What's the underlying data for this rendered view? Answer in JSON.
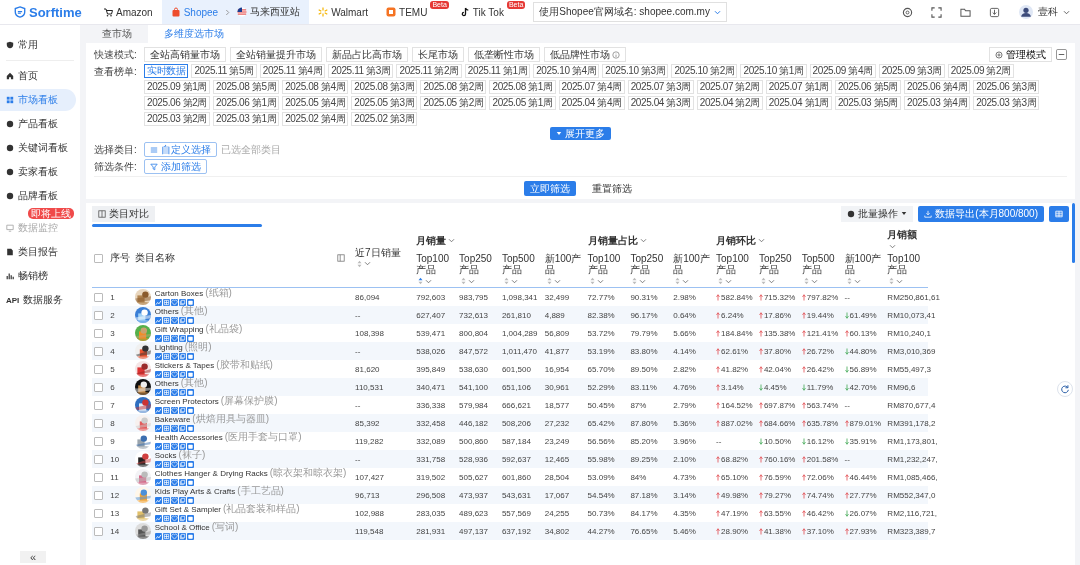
{
  "topbar": {
    "logo": "Sorftime",
    "platforms": [
      {
        "label": "Amazon",
        "selected": false
      },
      {
        "label": "Shopee",
        "selected": true,
        "site": "马来西亚站"
      },
      {
        "label": "Walmart",
        "selected": false
      },
      {
        "label": "TEMU",
        "selected": false,
        "beta": "Beta"
      },
      {
        "label": "Tik Tok",
        "selected": false,
        "beta": "Beta"
      }
    ],
    "domain": "使用Shopee官网域名: shopee.com.my",
    "user": "壹科"
  },
  "sidebar": {
    "items": [
      {
        "label": "常用",
        "selected": false,
        "disabled": false
      },
      {
        "label": "首页",
        "selected": false,
        "disabled": false
      },
      {
        "label": "市场看板",
        "selected": true,
        "disabled": false
      },
      {
        "label": "产品看板",
        "selected": false,
        "disabled": false
      },
      {
        "label": "关键词看板",
        "selected": false,
        "disabled": false
      },
      {
        "label": "卖家看板",
        "selected": false,
        "disabled": false
      },
      {
        "label": "品牌看板",
        "selected": false,
        "disabled": false
      },
      {
        "label": "数据监控",
        "selected": false,
        "disabled": true,
        "badge": "即将上线"
      },
      {
        "label": "类目报告",
        "selected": false,
        "disabled": false
      },
      {
        "label": "畅销榜",
        "selected": false,
        "disabled": false
      },
      {
        "label": "数据服务",
        "selected": false,
        "disabled": false,
        "prefix": "API"
      }
    ],
    "collapse": "«"
  },
  "tabs": [
    {
      "label": "查市场",
      "selected": false
    },
    {
      "label": "多维度选市场",
      "selected": true
    }
  ],
  "filters": {
    "quick": {
      "label": "快速模式:",
      "options": [
        "全站高销量市场",
        "全站销量提升市场",
        "新品占比高市场",
        "长尾市场",
        "低垄断性市场",
        "低品牌性市场"
      ],
      "manage": "管理模式"
    },
    "period": {
      "label": "查看榜单:",
      "options": [
        {
          "label": "实时数据",
          "selected": true
        },
        {
          "label": "2025.11 第5周",
          "selected": false
        },
        {
          "label": "2025.11 第4周",
          "selected": false
        },
        {
          "label": "2025.11 第3周",
          "selected": false
        },
        {
          "label": "2025.11 第2周",
          "selected": false
        },
        {
          "label": "2025.11 第1周",
          "selected": false
        },
        {
          "label": "2025.10 第4周",
          "selected": false
        },
        {
          "label": "2025.10 第3周",
          "selected": false
        },
        {
          "label": "2025.10 第2周",
          "selected": false
        },
        {
          "label": "2025.10 第1周",
          "selected": false
        },
        {
          "label": "2025.09 第4周",
          "selected": false
        },
        {
          "label": "2025.09 第3周",
          "selected": false
        },
        {
          "label": "2025.09 第2周",
          "selected": false
        },
        {
          "label": "2025.09 第1周",
          "selected": false
        },
        {
          "label": "2025.08 第5周",
          "selected": false
        },
        {
          "label": "2025.08 第4周",
          "selected": false
        },
        {
          "label": "2025.08 第3周",
          "selected": false
        },
        {
          "label": "2025.08 第2周",
          "selected": false
        },
        {
          "label": "2025.08 第1周",
          "selected": false
        },
        {
          "label": "2025.07 第4周",
          "selected": false
        },
        {
          "label": "2025.07 第3周",
          "selected": false
        },
        {
          "label": "2025.07 第2周",
          "selected": false
        },
        {
          "label": "2025.07 第1周",
          "selected": false
        },
        {
          "label": "2025.06 第5周",
          "selected": false
        },
        {
          "label": "2025.06 第4周",
          "selected": false
        },
        {
          "label": "2025.06 第3周",
          "selected": false
        },
        {
          "label": "2025.06 第2周",
          "selected": false
        },
        {
          "label": "2025.06 第1周",
          "selected": false
        },
        {
          "label": "2025.05 第4周",
          "selected": false
        },
        {
          "label": "2025.05 第3周",
          "selected": false
        },
        {
          "label": "2025.05 第2周",
          "selected": false
        },
        {
          "label": "2025.05 第1周",
          "selected": false
        },
        {
          "label": "2025.04 第4周",
          "selected": false
        },
        {
          "label": "2025.04 第3周",
          "selected": false
        },
        {
          "label": "2025.04 第2周",
          "selected": false
        },
        {
          "label": "2025.04 第1周",
          "selected": false
        },
        {
          "label": "2025.03 第5周",
          "selected": false
        },
        {
          "label": "2025.03 第4周",
          "selected": false
        },
        {
          "label": "2025.03 第3周",
          "selected": false
        },
        {
          "label": "2025.03 第2周",
          "selected": false
        },
        {
          "label": "2025.03 第1周",
          "selected": false
        },
        {
          "label": "2025.02 第4周",
          "selected": false
        },
        {
          "label": "2025.02 第3周",
          "selected": false
        }
      ],
      "expand": "展开更多"
    },
    "category": {
      "label": "选择类目:",
      "button": "自定义选择",
      "note": "已选全部类目"
    },
    "conditions": {
      "label": "筛选条件:",
      "button": "添加筛选"
    },
    "actions": [
      {
        "label": "立即筛选",
        "kind": "primary"
      },
      {
        "label": "重置筛选",
        "kind": "plain"
      }
    ]
  },
  "table": {
    "compare": "类目对比",
    "batch": "批量操作",
    "export": "数据导出(本月800/800)",
    "select_all": {
      "checked": false
    },
    "columns": {
      "index": "序号",
      "name": "类目名称",
      "sales_7d": "近7日销量",
      "groups": [
        {
          "label": "月销量",
          "subs": [
            "Top100产品",
            "Top250产品",
            "Top500产品",
            "新100产品"
          ]
        },
        {
          "label": "月销量占比",
          "subs": [
            "Top100产品",
            "Top250产品",
            "新100产品"
          ]
        },
        {
          "label": "月销环比",
          "subs": [
            "Top100产品",
            "Top250产品",
            "Top500产品",
            "新100产品"
          ]
        },
        {
          "label": "月销额",
          "subs": [
            "Top100产品"
          ]
        }
      ]
    },
    "rows": [
      {
        "checked": false,
        "index": "1",
        "name": "Carton Boxes",
        "name_cn": "(纸箱)",
        "sales_7d": "86,094",
        "sales": [
          "792,603",
          "983,795",
          "1,098,341",
          "32,499"
        ],
        "share": [
          "72.77%",
          "90.31%",
          "2.98%"
        ],
        "growth": [
          {
            "up": true,
            "value": "582.84%"
          },
          {
            "up": true,
            "value": "715.32%"
          },
          {
            "up": true,
            "value": "797.82%"
          },
          {
            "value": "--"
          }
        ],
        "revenue": "RM250,861,61"
      },
      {
        "checked": false,
        "index": "2",
        "name": "Others",
        "name_cn": "(其他)",
        "sales_7d": "--",
        "sales": [
          "627,407",
          "732,613",
          "261,810",
          "4,889"
        ],
        "share": [
          "82.38%",
          "96.17%",
          "0.64%"
        ],
        "growth": [
          {
            "up": true,
            "value": "6.24%"
          },
          {
            "up": true,
            "value": "17.86%"
          },
          {
            "up": true,
            "value": "19.44%"
          },
          {
            "up": false,
            "value": "61.49%"
          }
        ],
        "revenue": "RM10,073,41"
      },
      {
        "checked": false,
        "index": "3",
        "name": "Gift Wrapping",
        "name_cn": "(礼品袋)",
        "sales_7d": "108,398",
        "sales": [
          "539,471",
          "800,804",
          "1,004,289",
          "56,809"
        ],
        "share": [
          "53.72%",
          "79.79%",
          "5.66%"
        ],
        "growth": [
          {
            "up": true,
            "value": "184.84%"
          },
          {
            "up": true,
            "value": "135.38%"
          },
          {
            "up": true,
            "value": "121.41%"
          },
          {
            "up": true,
            "value": "60.13%"
          }
        ],
        "revenue": "RM10,240,1"
      },
      {
        "checked": false,
        "index": "4",
        "name": "Lighting",
        "name_cn": "(照明)",
        "sales_7d": "--",
        "sales": [
          "538,026",
          "847,572",
          "1,011,470",
          "41,877"
        ],
        "share": [
          "53.19%",
          "83.80%",
          "4.14%"
        ],
        "growth": [
          {
            "up": true,
            "value": "62.61%"
          },
          {
            "up": true,
            "value": "37.80%"
          },
          {
            "up": true,
            "value": "26.72%"
          },
          {
            "up": false,
            "value": "44.80%"
          }
        ],
        "revenue": "RM3,010,369"
      },
      {
        "checked": false,
        "index": "5",
        "name": "Stickers & Tapes",
        "name_cn": "(胶带和贴纸)",
        "sales_7d": "81,620",
        "sales": [
          "395,849",
          "538,630",
          "601,500",
          "16,954"
        ],
        "share": [
          "65.70%",
          "89.50%",
          "2.82%"
        ],
        "growth": [
          {
            "up": true,
            "value": "41.82%"
          },
          {
            "up": true,
            "value": "42.04%"
          },
          {
            "up": true,
            "value": "26.42%"
          },
          {
            "up": false,
            "value": "56.89%"
          }
        ],
        "revenue": "RM55,497,3"
      },
      {
        "checked": false,
        "index": "6",
        "name": "Others",
        "name_cn": "(其他)",
        "sales_7d": "110,531",
        "sales": [
          "340,471",
          "541,100",
          "651,106",
          "30,961"
        ],
        "share": [
          "52.29%",
          "83.11%",
          "4.76%"
        ],
        "growth": [
          {
            "up": true,
            "value": "3.14%"
          },
          {
            "up": false,
            "value": "4.45%"
          },
          {
            "up": false,
            "value": "11.79%"
          },
          {
            "up": false,
            "value": "42.70%"
          }
        ],
        "revenue": "RM96,6"
      },
      {
        "checked": false,
        "index": "7",
        "name": "Screen Protectors",
        "name_cn": "(屏幕保护膜)",
        "sales_7d": "--",
        "sales": [
          "336,338",
          "579,984",
          "666,621",
          "18,577"
        ],
        "share": [
          "50.45%",
          "87%",
          "2.79%"
        ],
        "growth": [
          {
            "up": true,
            "value": "164.52%"
          },
          {
            "up": true,
            "value": "697.87%"
          },
          {
            "up": true,
            "value": "563.74%"
          },
          {
            "value": "--"
          }
        ],
        "revenue": "RM870,677,4"
      },
      {
        "checked": false,
        "index": "8",
        "name": "Bakeware",
        "name_cn": "(烘焙用具与器皿)",
        "sales_7d": "85,392",
        "sales": [
          "332,458",
          "446,182",
          "508,206",
          "27,232"
        ],
        "share": [
          "65.42%",
          "87.80%",
          "5.36%"
        ],
        "growth": [
          {
            "up": true,
            "value": "887.02%"
          },
          {
            "up": true,
            "value": "684.66%"
          },
          {
            "up": true,
            "value": "635.78%"
          },
          {
            "up": true,
            "value": "879.01%"
          }
        ],
        "revenue": "RM391,178,2"
      },
      {
        "checked": false,
        "index": "9",
        "name": "Health Accessories",
        "name_cn": "(医用手套与口罩)",
        "sales_7d": "119,282",
        "sales": [
          "332,089",
          "500,860",
          "587,184",
          "23,249"
        ],
        "share": [
          "56.56%",
          "85.20%",
          "3.96%"
        ],
        "growth": [
          {
            "value": "--"
          },
          {
            "up": false,
            "value": "10.50%"
          },
          {
            "up": false,
            "value": "16.12%"
          },
          {
            "up": false,
            "value": "35.91%"
          }
        ],
        "revenue": "RM1,173,801,"
      },
      {
        "checked": false,
        "index": "10",
        "name": "Socks",
        "name_cn": "(袜子)",
        "sales_7d": "--",
        "sales": [
          "331,758",
          "528,936",
          "592,637",
          "12,465"
        ],
        "share": [
          "55.98%",
          "89.25%",
          "2.10%"
        ],
        "growth": [
          {
            "up": true,
            "value": "68.82%"
          },
          {
            "up": true,
            "value": "760.16%"
          },
          {
            "up": true,
            "value": "201.58%"
          },
          {
            "value": "--"
          }
        ],
        "revenue": "RM1,232,247,"
      },
      {
        "checked": false,
        "index": "11",
        "name": "Clothes Hanger & Drying Racks",
        "name_cn": "(晾衣架和晾衣架)",
        "sales_7d": "107,427",
        "sales": [
          "319,502",
          "505,627",
          "601,860",
          "28,504"
        ],
        "share": [
          "53.09%",
          "84%",
          "4.73%"
        ],
        "growth": [
          {
            "up": true,
            "value": "65.10%"
          },
          {
            "up": true,
            "value": "76.59%"
          },
          {
            "up": true,
            "value": "72.06%"
          },
          {
            "up": true,
            "value": "46.44%"
          }
        ],
        "revenue": "RM1,085,466,"
      },
      {
        "checked": false,
        "index": "12",
        "name": "Kids Play Arts & Crafts",
        "name_cn": "(手工艺品)",
        "sales_7d": "96,713",
        "sales": [
          "296,508",
          "473,937",
          "543,631",
          "17,067"
        ],
        "share": [
          "54.54%",
          "87.18%",
          "3.14%"
        ],
        "growth": [
          {
            "up": true,
            "value": "49.98%"
          },
          {
            "up": true,
            "value": "79.27%"
          },
          {
            "up": true,
            "value": "74.74%"
          },
          {
            "up": true,
            "value": "27.77%"
          }
        ],
        "revenue": "RM552,347,0"
      },
      {
        "checked": false,
        "index": "13",
        "name": "Gift Set & Sampler",
        "name_cn": "(礼品套装和样品)",
        "sales_7d": "102,988",
        "sales": [
          "283,035",
          "489,623",
          "557,569",
          "24,255"
        ],
        "share": [
          "50.73%",
          "84.17%",
          "4.35%"
        ],
        "growth": [
          {
            "up": true,
            "value": "47.19%"
          },
          {
            "up": true,
            "value": "63.55%"
          },
          {
            "up": true,
            "value": "46.42%"
          },
          {
            "up": false,
            "value": "26.07%"
          }
        ],
        "revenue": "RM2,116,721,"
      },
      {
        "checked": false,
        "index": "14",
        "name": "School & Office",
        "name_cn": "(写词)",
        "sales_7d": "119,548",
        "sales": [
          "281,931",
          "497,137",
          "637,192",
          "34,802"
        ],
        "share": [
          "44.27%",
          "76.65%",
          "5.46%"
        ],
        "growth": [
          {
            "up": true,
            "value": "28.90%"
          },
          {
            "up": true,
            "value": "41.38%"
          },
          {
            "up": true,
            "value": "37.10%"
          },
          {
            "up": true,
            "value": "27.93%"
          }
        ],
        "revenue": "RM323,389,7"
      }
    ]
  }
}
